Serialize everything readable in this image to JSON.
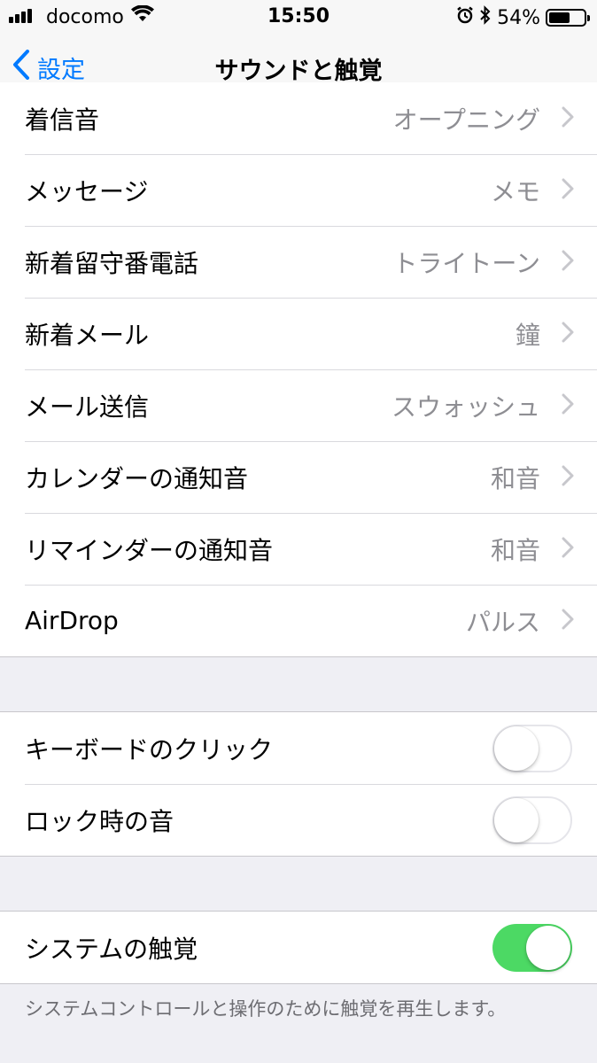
{
  "status_bar": {
    "carrier": "docomo",
    "time": "15:50",
    "battery": "54%",
    "icons": [
      "signal-icon",
      "wifi-icon",
      "alarm-icon",
      "bluetooth-icon",
      "battery-icon"
    ]
  },
  "nav": {
    "back_label": "設定",
    "title": "サウンドと触覚"
  },
  "sounds": [
    {
      "label": "着信音",
      "value": "オープニング"
    },
    {
      "label": "メッセージ",
      "value": "メモ"
    },
    {
      "label": "新着留守番電話",
      "value": "トライトーン"
    },
    {
      "label": "新着メール",
      "value": "鐘"
    },
    {
      "label": "メール送信",
      "value": "スウォッシュ"
    },
    {
      "label": "カレンダーの通知音",
      "value": "和音"
    },
    {
      "label": "リマインダーの通知音",
      "value": "和音"
    },
    {
      "label": "AirDrop",
      "value": "パルス"
    }
  ],
  "toggles": [
    {
      "label": "キーボードのクリック",
      "state": "off"
    },
    {
      "label": "ロック時の音",
      "state": "off"
    }
  ],
  "haptics": {
    "label": "システムの触覚",
    "state": "on",
    "footer": "システムコントロールと操作のために触覚を再生します。"
  },
  "colors": {
    "accent": "#007aff",
    "toggle_on": "#4cd964",
    "secondary_text": "#8e8e93",
    "background": "#efeff4"
  }
}
